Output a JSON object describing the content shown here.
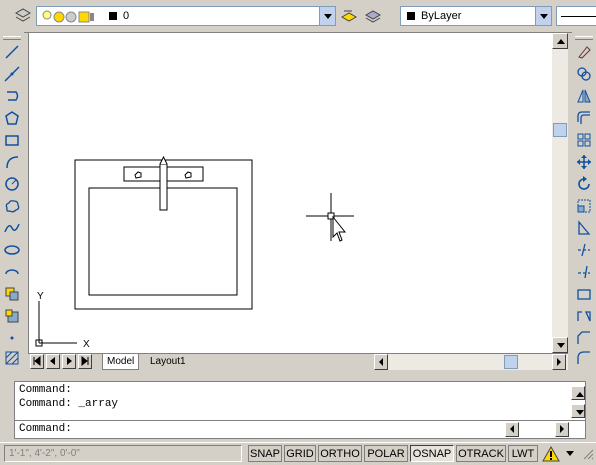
{
  "toolbar": {
    "layer_value": "0",
    "color_value": "ByLayer"
  },
  "tabs": {
    "model": "Model",
    "layout1": "Layout1"
  },
  "axes": {
    "x": "X",
    "y": "Y"
  },
  "command": {
    "line1": "Command:",
    "line2": "Command: _array",
    "prompt": "Command:"
  },
  "status": {
    "coords": "1'-1\", 4'-2\", 0'-0\"",
    "buttons": [
      "SNAP",
      "GRID",
      "ORTHO",
      "POLAR",
      "OSNAP",
      "OTRACK",
      "LWT"
    ]
  }
}
